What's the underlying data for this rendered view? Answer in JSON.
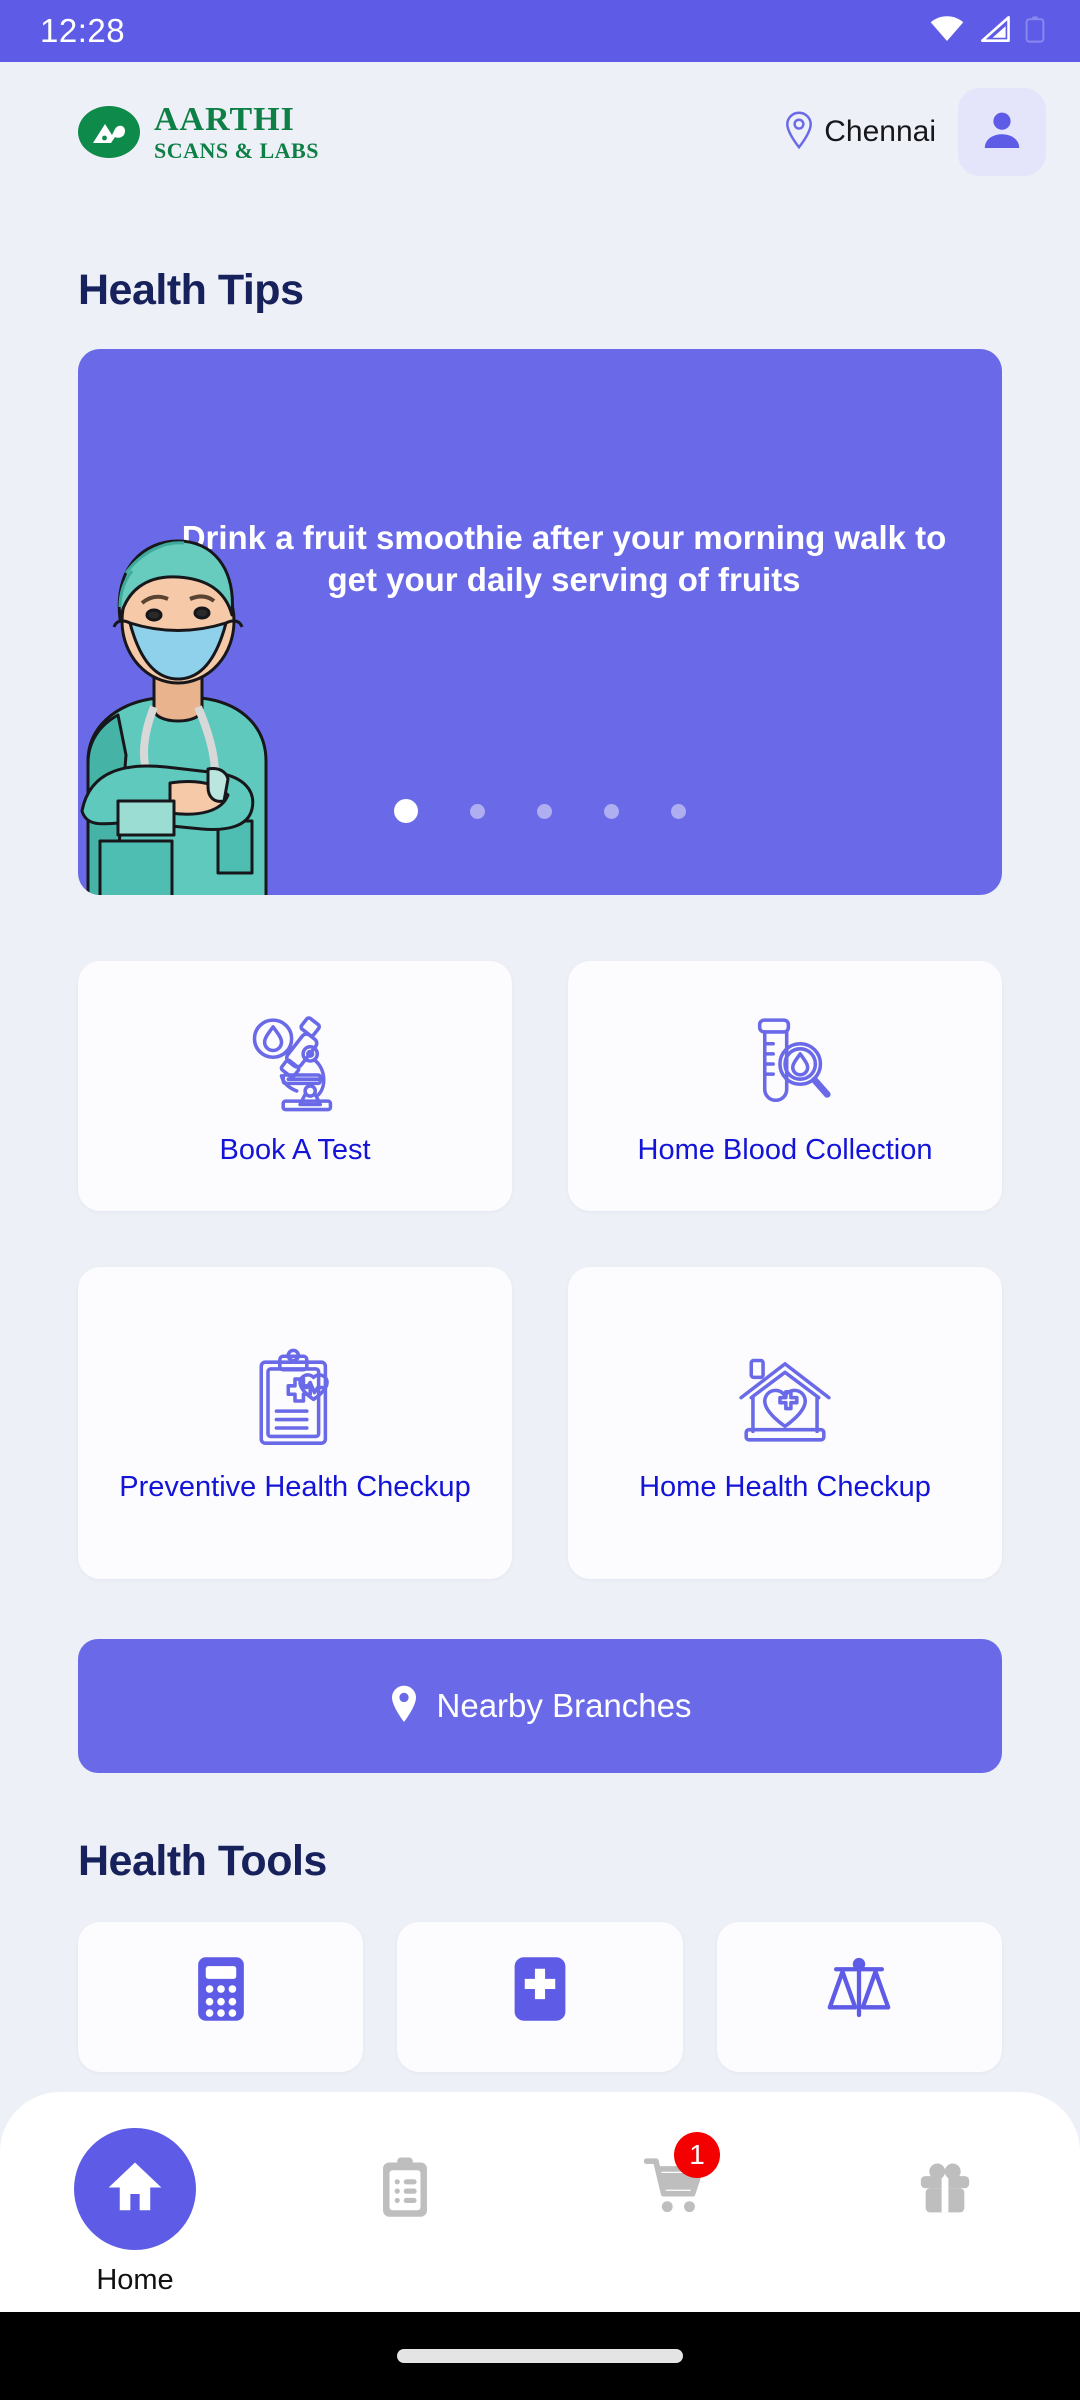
{
  "status_bar": {
    "time": "12:28",
    "icons": [
      "wifi-icon",
      "cellular-signal-icon",
      "battery-icon"
    ]
  },
  "header": {
    "logo_line1": "AARTHI",
    "logo_line2": "SCANS & LABS",
    "location_icon": "location-pin-icon",
    "location": "Chennai",
    "profile_icon": "person-icon"
  },
  "health_tips": {
    "title": "Health Tips",
    "slide_text": "Drink a fruit smoothie after your morning walk to get your daily serving of fruits",
    "illustration": "nurse-illustration",
    "total_slides": 5,
    "active_slide": 1
  },
  "services": [
    {
      "label": "Book A Test",
      "icon": "microscope-icon"
    },
    {
      "label": "Home Blood Collection",
      "icon": "test-tube-magnifier-icon"
    },
    {
      "label": "Preventive Health Checkup",
      "icon": "clipboard-health-icon"
    },
    {
      "label": "Home Health Checkup",
      "icon": "house-heart-icon"
    }
  ],
  "nearby_branches": {
    "label": "Nearby Branches",
    "icon": "location-pin-filled-icon"
  },
  "health_tools": {
    "title": "Health Tools",
    "items": [
      {
        "icon": "calculator-icon"
      },
      {
        "icon": "medical-cross-icon"
      },
      {
        "icon": "balance-scale-icon"
      }
    ]
  },
  "bottom_nav": {
    "items": [
      {
        "label": "Home",
        "icon": "home-icon",
        "active": true,
        "badge": ""
      },
      {
        "label": "",
        "icon": "clipboard-icon",
        "active": false,
        "badge": ""
      },
      {
        "label": "",
        "icon": "cart-icon",
        "active": false,
        "badge": "1"
      },
      {
        "label": "",
        "icon": "gift-icon",
        "active": false,
        "badge": ""
      }
    ]
  },
  "colors": {
    "primary": "#5E5CE6",
    "banner": "#6A6AE8",
    "background": "#EDF0F7",
    "card": "#FCFCFE",
    "heading": "#17215B",
    "link": "#1414D8",
    "icon_outline": "#6A6AE8",
    "logo_green": "#0E7F45",
    "badge": "#F50000"
  }
}
